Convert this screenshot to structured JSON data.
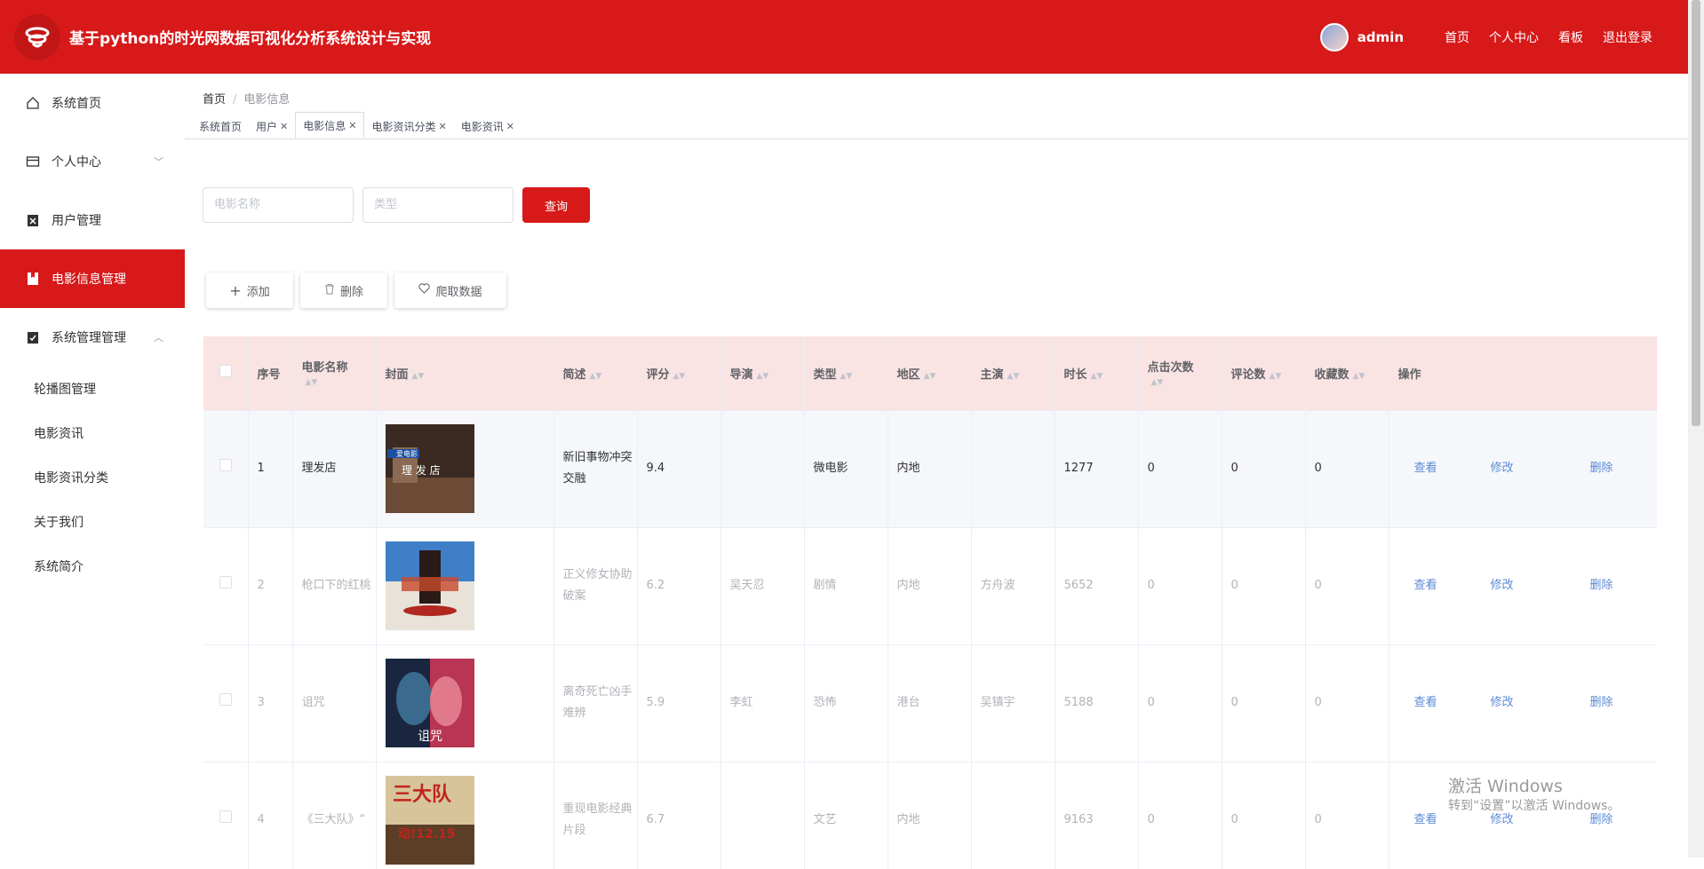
{
  "header": {
    "title": "基于python的时光网数据可视化分析系统设计与实现",
    "user": "admin",
    "nav": [
      "首页",
      "个人中心",
      "看板",
      "退出登录"
    ],
    "brand_color": "#d7191a"
  },
  "sidebar": {
    "items": [
      {
        "label": "系统首页",
        "icon": "home-icon"
      },
      {
        "label": "个人中心",
        "icon": "card-icon"
      },
      {
        "label": "用户管理",
        "icon": "clipboard-icon"
      },
      {
        "label": "电影信息管理",
        "icon": "book-icon"
      },
      {
        "label": "系统管理管理",
        "icon": "clipboard-icon"
      }
    ],
    "sub_items": [
      "轮播图管理",
      "电影资讯",
      "电影资讯分类",
      "关于我们",
      "系统简介"
    ]
  },
  "breadcrumb": {
    "home": "首页",
    "current": "电影信息"
  },
  "tabs": [
    {
      "label": "系统首页",
      "closable": false
    },
    {
      "label": "用户",
      "closable": true
    },
    {
      "label": "电影信息",
      "closable": true
    },
    {
      "label": "电影资讯分类",
      "closable": true
    },
    {
      "label": "电影资讯",
      "closable": true
    }
  ],
  "search": {
    "name_placeholder": "电影名称",
    "type_placeholder": "类型",
    "button": "查询"
  },
  "actions": {
    "add": "添加",
    "delete": "删除",
    "crawl": "爬取数据"
  },
  "table": {
    "headers": [
      "序号",
      "电影名称",
      "封面",
      "简述",
      "评分",
      "导演",
      "类型",
      "地区",
      "主演",
      "时长",
      "点击次数",
      "评论数",
      "收藏数",
      "操作"
    ],
    "ops": {
      "view": "查看",
      "edit": "修改",
      "del": "删除"
    },
    "rows": [
      {
        "idx": "1",
        "name": "理发店",
        "summary": "新旧事物冲突交融",
        "score": "9.4",
        "director": "",
        "type": "微电影",
        "region": "内地",
        "actor": "",
        "duration": "1277",
        "clicks": "0",
        "comments": "0",
        "favs": "0"
      },
      {
        "idx": "2",
        "name": "枪口下的红桃",
        "summary": "正义修女协助破案",
        "score": "6.2",
        "director": "吴天忍",
        "type": "剧情",
        "region": "内地",
        "actor": "方舟波",
        "duration": "5652",
        "clicks": "0",
        "comments": "0",
        "favs": "0"
      },
      {
        "idx": "3",
        "name": "诅咒",
        "summary": "离奇死亡凶手难辨",
        "score": "5.9",
        "director": "李虹",
        "type": "恐怖",
        "region": "港台",
        "actor": "吴镇宇",
        "duration": "5188",
        "clicks": "0",
        "comments": "0",
        "favs": "0"
      },
      {
        "idx": "4",
        "name": "《三大队》“",
        "summary": "重现电影经典片段",
        "score": "6.7",
        "director": "",
        "type": "文艺",
        "region": "内地",
        "actor": "",
        "duration": "9163",
        "clicks": "0",
        "comments": "0",
        "favs": "0"
      }
    ]
  },
  "posters": {
    "p1_text": "理 发 店",
    "p1_brand": "爱电影",
    "p3_text": "诅咒",
    "p4_title": "三大队",
    "p4_date": "动!12.15"
  },
  "watermark": {
    "line1": "激活 Windows",
    "line2": "转到“设置”以激活 Windows。"
  }
}
